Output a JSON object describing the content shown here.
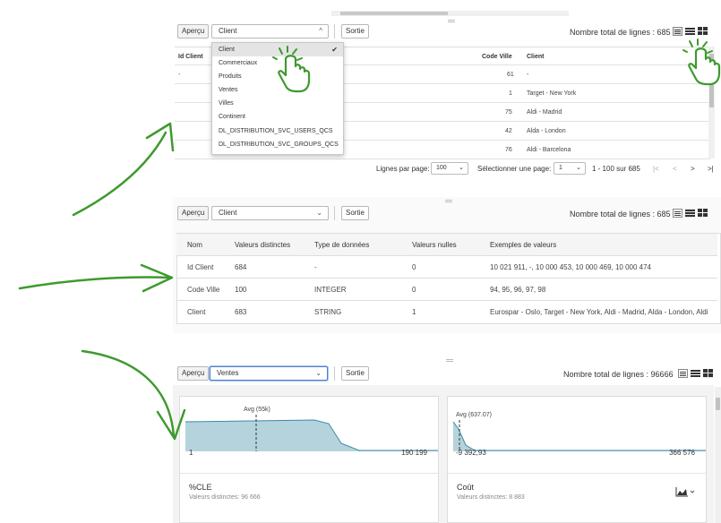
{
  "panel1": {
    "preview_label": "Aperçu",
    "select_value": "Client",
    "output_label": "Sortie",
    "total_rows": "Nombre total de lignes : 685",
    "columns": [
      "Id Client",
      "Code Ville",
      "Client"
    ],
    "rows": [
      {
        "id": "-",
        "code": "61",
        "client": "-"
      },
      {
        "id": "",
        "code": "1",
        "client": "Target - New York"
      },
      {
        "id": "",
        "code": "75",
        "client": "Aldi - Madrid"
      },
      {
        "id": "",
        "code": "42",
        "client": "Alda - London"
      },
      {
        "id": "",
        "code": "76",
        "client": "Aldi - Barcelona"
      }
    ],
    "dropdown_options": [
      "Client",
      "Commerciaux",
      "Produits",
      "Ventes",
      "Villes",
      "Continent",
      "DL_DISTRIBUTION_SVC_USERS_QCS",
      "DL_DISTRIBUTION_SVC_GROUPS_QCS"
    ],
    "pager": {
      "rows_per_page_label": "Lignes par page:",
      "rows_per_page": "100",
      "select_page_label": "Sélectionner une page:",
      "page": "1",
      "range": "1 - 100 sur 685",
      "first": "|<",
      "prev": "<",
      "next": ">",
      "last": ">|"
    }
  },
  "panel2": {
    "preview_label": "Aperçu",
    "select_value": "Client",
    "output_label": "Sortie",
    "total_rows": "Nombre total de lignes : 685",
    "columns": [
      "Nom",
      "Valeurs distinctes",
      "Type de données",
      "Valeurs nulles",
      "Exemples de valeurs"
    ],
    "rows": [
      {
        "name": "Id Client",
        "distinct": "684",
        "type": "-",
        "nulls": "0",
        "examples": "10 021 911, -, 10 000 453, 10 000 469, 10 000 474"
      },
      {
        "name": "Code Ville",
        "distinct": "100",
        "type": "INTEGER",
        "nulls": "0",
        "examples": "94, 95, 96, 97, 98"
      },
      {
        "name": "Client",
        "distinct": "683",
        "type": "STRING",
        "nulls": "1",
        "examples": "Eurospar - Oslo, Target - New York, Aldi - Madrid, Alda - London, Aldi"
      }
    ]
  },
  "panel3": {
    "preview_label": "Aperçu",
    "select_value": "Ventes",
    "output_label": "Sortie",
    "total_rows": "Nombre total de lignes : 96666",
    "cards": [
      {
        "avg_label": "Avg (55k)",
        "min": "1",
        "max": "190 199",
        "title": "%CLE",
        "subtitle": "Valeurs distinctes: 96 666"
      },
      {
        "avg_label": "Avg (637.07)",
        "min": "-9 392,93",
        "max": "366 576",
        "title": "Coût",
        "subtitle": "Valeurs distinctes: 8 883"
      }
    ]
  },
  "colors": {
    "arrow_green": "#3e9a2e",
    "hist_fill": "#b5d3dc",
    "hist_stroke": "#3a8ba6"
  },
  "icons": [
    "hand-pointer-icon",
    "check-icon",
    "chevron-down-icon",
    "table-view-icon",
    "list-view-icon",
    "grid-view-icon",
    "chart-icon"
  ]
}
